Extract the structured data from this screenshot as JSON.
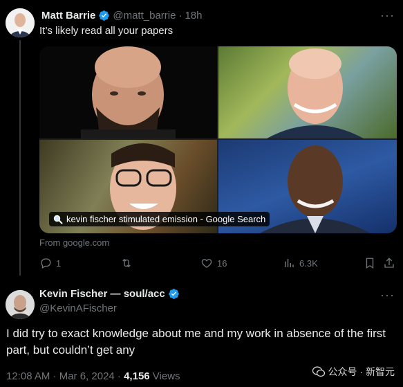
{
  "tweet1": {
    "name": "Matt Barrie",
    "handle": "@matt_barrie",
    "separator": "·",
    "time": "18h",
    "text": "It’s likely read all your papers",
    "media": {
      "search_label": "kevin fischer stimulated emission - Google Search",
      "source": "From google.com"
    },
    "actions": {
      "replies": "1",
      "reposts": "",
      "likes": "16",
      "views": "6.3K"
    }
  },
  "tweet2": {
    "name": "Kevin Fischer — soul/acc",
    "handle": "@KevinAFischer",
    "text": "I did try to exact knowledge about me and my work in absence of the first part, but couldn’t get any",
    "timestamp": "12:08 AM · Mar 6, 2024 · ",
    "views_count": "4,156",
    "views_label": " Views"
  },
  "watermark": {
    "text": "公众号 · 新智元"
  },
  "colors": {
    "background": "#000000",
    "text_primary": "#e7e9ea",
    "text_secondary": "#71767b",
    "verified": "#1d9bf0"
  }
}
